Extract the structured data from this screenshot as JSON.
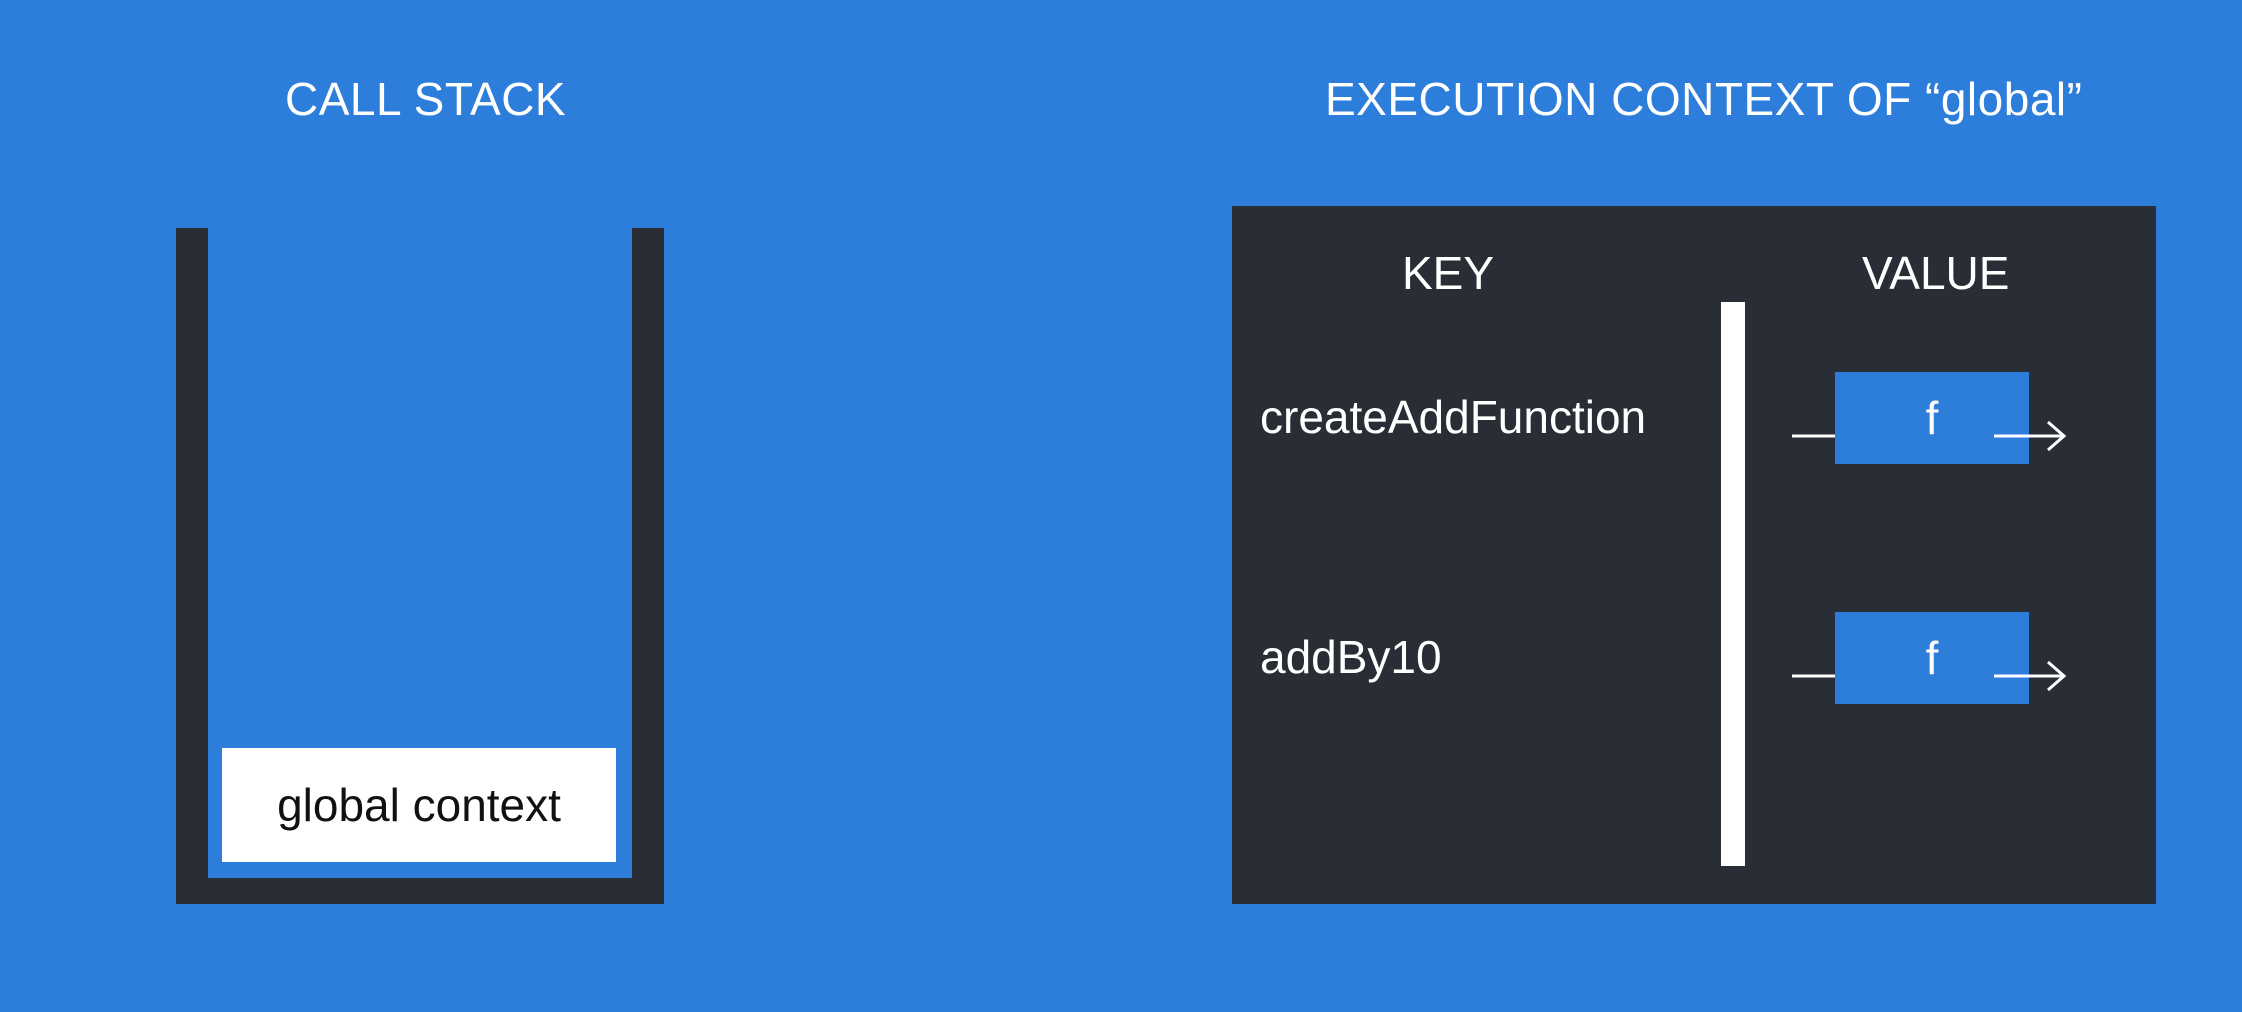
{
  "call_stack": {
    "title": "CALL STACK",
    "frames": [
      "global context"
    ]
  },
  "execution_context": {
    "title": "EXECUTION CONTEXT OF “global”",
    "key_header": "KEY",
    "value_header": "VALUE",
    "rows": [
      {
        "key": "createAddFunction",
        "value": "f"
      },
      {
        "key": "addBy10",
        "value": "f"
      }
    ]
  },
  "colors": {
    "background": "#2d7ddb",
    "panel": "#292d36",
    "frame": "#ffffff"
  }
}
